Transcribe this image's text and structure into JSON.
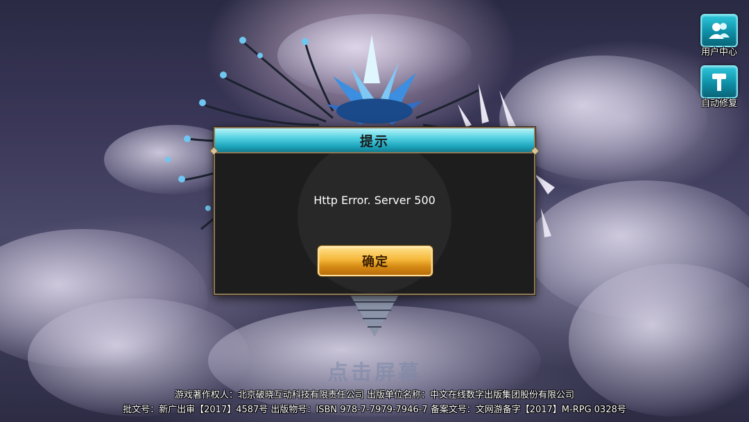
{
  "side_buttons": [
    {
      "label": "用户中心",
      "icon": "user-center-icon"
    },
    {
      "label": "自动修复",
      "icon": "hammer-icon"
    }
  ],
  "dialog": {
    "title": "提示",
    "message": "Http Error. Server 500",
    "confirm_label": "确定"
  },
  "tap_prompt": "点击屏幕",
  "footer": {
    "line1": "游戏著作权人：北京破晓互动科技有限责任公司  出版单位名称：中文在线数字出版集团股份有限公司",
    "line2": "批文号：新广出审【2017】4587号  出版物号：ISBN 978-7-7979-7946-7  备案文号：文网游备字【2017】M-RPG 0328号"
  },
  "colors": {
    "header_accent": "#1ea6bd",
    "button_gold": "#f5b83a",
    "side_button_teal": "#0e8fa6"
  }
}
